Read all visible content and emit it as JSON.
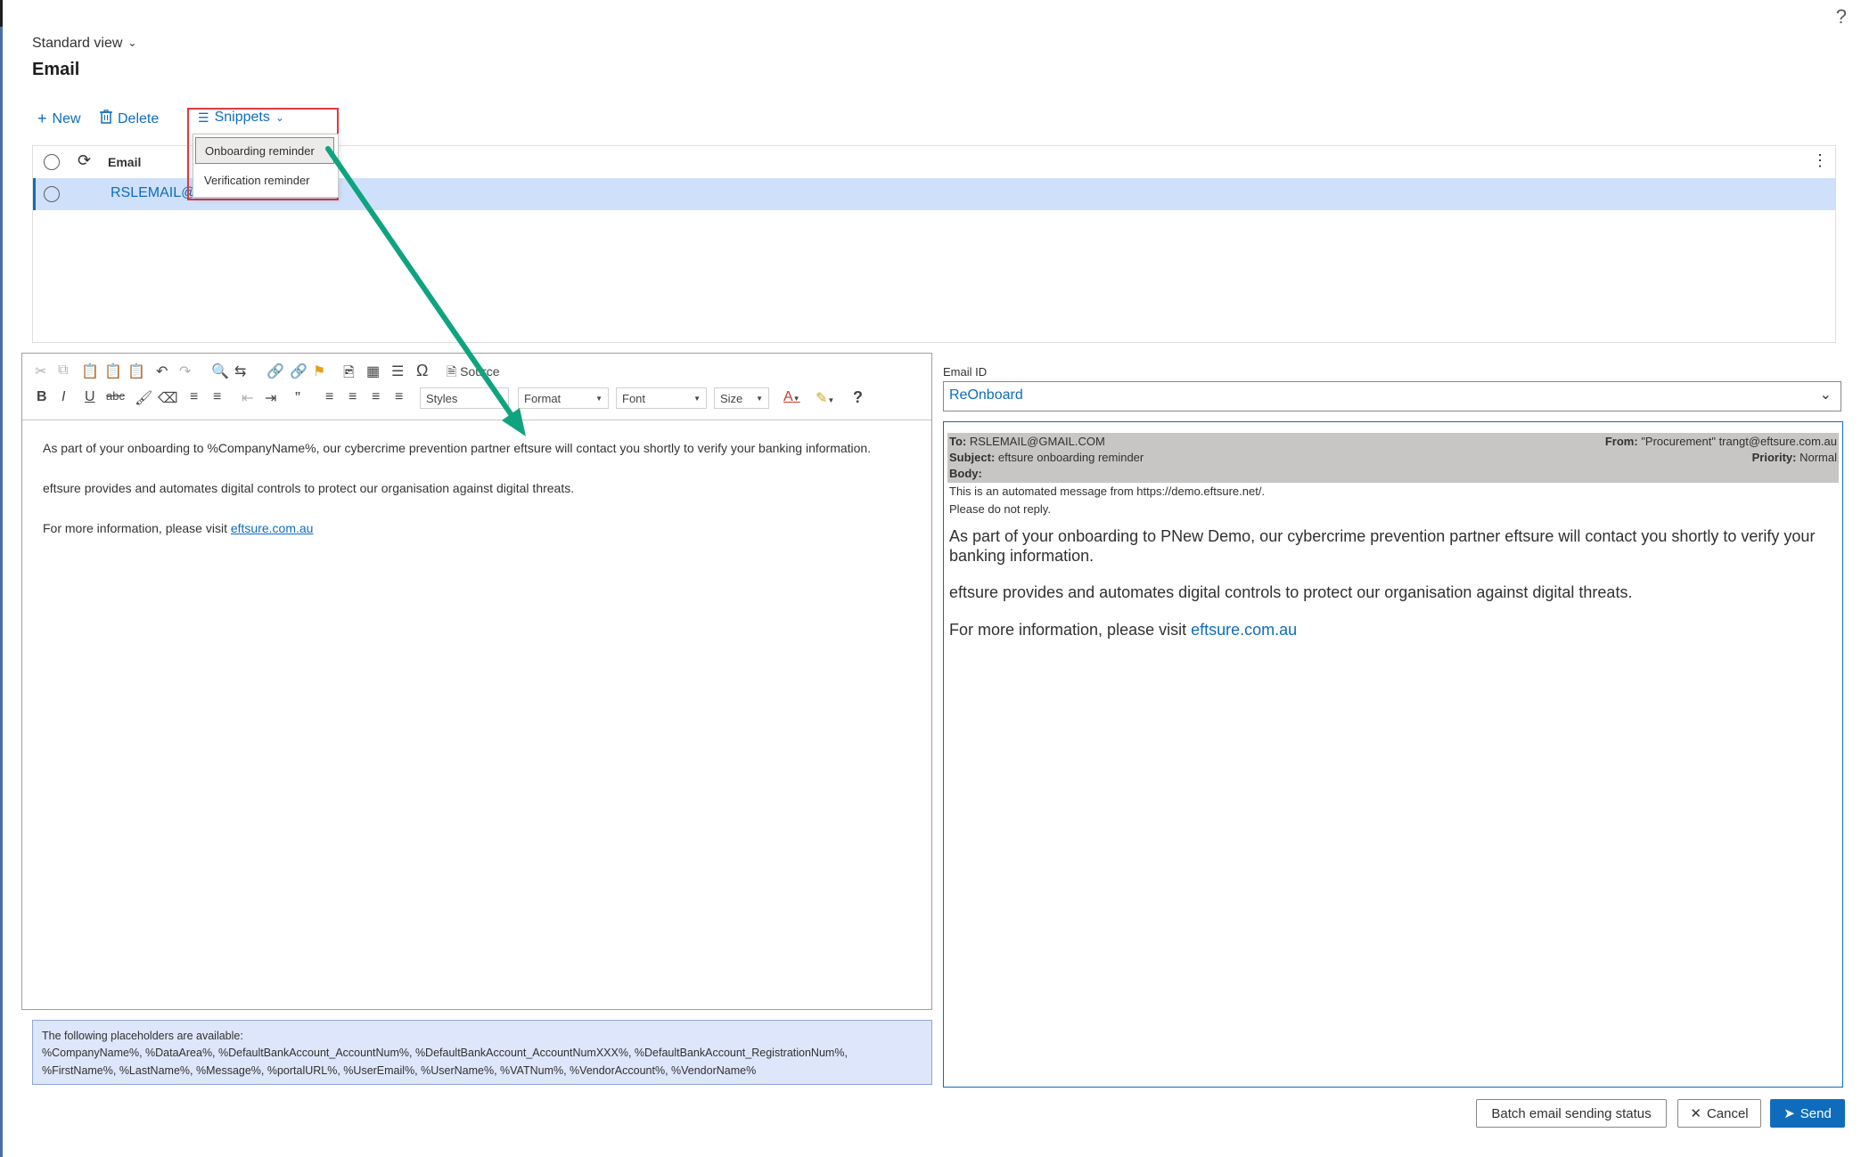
{
  "header": {
    "view_label": "Standard view",
    "page_title": "Email",
    "help_glyph": "?"
  },
  "actions": {
    "new_label": "New",
    "delete_label": "Delete",
    "snippets_label": "Snippets"
  },
  "snippets_menu": {
    "items": [
      "Onboarding reminder",
      "Verification reminder"
    ]
  },
  "grid": {
    "column_email": "Email",
    "rows": [
      {
        "email": "RSLEMAIL@GMAIL.COM"
      }
    ]
  },
  "editor": {
    "source_label": "Source",
    "styles_label": "Styles",
    "format_label": "Format",
    "font_label": "Font",
    "size_label": "Size",
    "paragraphs": [
      "As part of your onboarding to %CompanyName%, our cybercrime prevention partner eftsure will contact you shortly to verify your banking information.",
      "eftsure provides and automates digital controls to protect our organisation against digital threats."
    ],
    "link_prefix": "For more information, please visit ",
    "link_text": "eftsure.com.au"
  },
  "placeholders": {
    "title": "The following placeholders are available:",
    "line1": "%CompanyName%, %DataArea%, %DefaultBankAccount_AccountNum%, %DefaultBankAccount_AccountNumXXX%, %DefaultBankAccount_RegistrationNum%,",
    "line2": "%FirstName%, %LastName%, %Message%, %portalURL%, %UserEmail%, %UserName%, %VATNum%, %VendorAccount%, %VendorName%"
  },
  "email_id": {
    "label": "Email ID",
    "value": "ReOnboard"
  },
  "preview": {
    "to_label": "To:",
    "to_value": "RSLEMAIL@GMAIL.COM",
    "from_label": "From:",
    "from_value": "\"Procurement\" trangt@eftsure.com.au",
    "subject_label": "Subject:",
    "subject_value": "eftsure onboarding reminder",
    "priority_label": "Priority:",
    "priority_value": "Normal",
    "body_label": "Body:",
    "automated_note": "This is an automated message from https://demo.eftsure.net/.",
    "no_reply_note": "Please do not reply.",
    "paragraphs": [
      "As part of your onboarding to PNew Demo, our cybercrime prevention partner eftsure will contact you shortly to verify your banking information.",
      "eftsure provides and automates digital controls to protect our organisation against digital threats."
    ],
    "link_prefix": "For more information, please visit ",
    "link_text": "eftsure.com.au"
  },
  "footer": {
    "batch_label": "Batch email sending status",
    "cancel_label": "Cancel",
    "send_label": "Send"
  },
  "colors": {
    "accent": "#0f6cbd",
    "highlight_box": "#e0393e",
    "annotation_arrow": "#10a37f",
    "selected_row": "#cfe0fb"
  }
}
